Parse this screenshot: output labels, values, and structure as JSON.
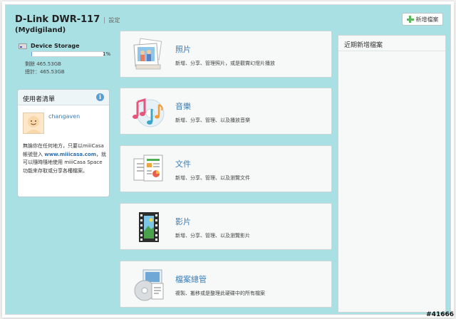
{
  "header": {
    "device": "D-Link DWR-117",
    "separator": "|",
    "settings_link": "設定",
    "subtitle": "(Mydigiland)",
    "new_button": "新增檔案"
  },
  "storage": {
    "label": "Device Storage",
    "percent_text": "1%",
    "fill_percent": 1,
    "remaining": "剩餘 465.53GB",
    "total": "總計：465.53GB"
  },
  "users": {
    "title": "使用者清單",
    "username": "changaven",
    "desc_line1": "無論你在任何地方，只要以miiiCasa 帳號登入",
    "desc_link": "www.miiicasa.com",
    "desc_line2": "，就可以隨時隨地使用 miiiCasa Space 功能來存取或分享各種檔案。"
  },
  "tiles": [
    {
      "title": "照片",
      "desc": "新增、分享、管理照片，或是觀賞幻燈片播放",
      "icon": "photos-icon"
    },
    {
      "title": "音樂",
      "desc": "新增、分享、管理、以及播放音樂",
      "icon": "music-icon"
    },
    {
      "title": "文件",
      "desc": "新增、分享、管理、以及瀏覽文件",
      "icon": "documents-icon"
    },
    {
      "title": "影片",
      "desc": "新增、分享、管理、以及瀏覽影片",
      "icon": "video-icon"
    },
    {
      "title": "檔案總管",
      "desc": "複製、搬移或是整理此硬碟中的所有檔案",
      "icon": "file-manager-icon"
    }
  ],
  "recent": {
    "title": "近期新增檔案"
  },
  "watermark": "#41666"
}
